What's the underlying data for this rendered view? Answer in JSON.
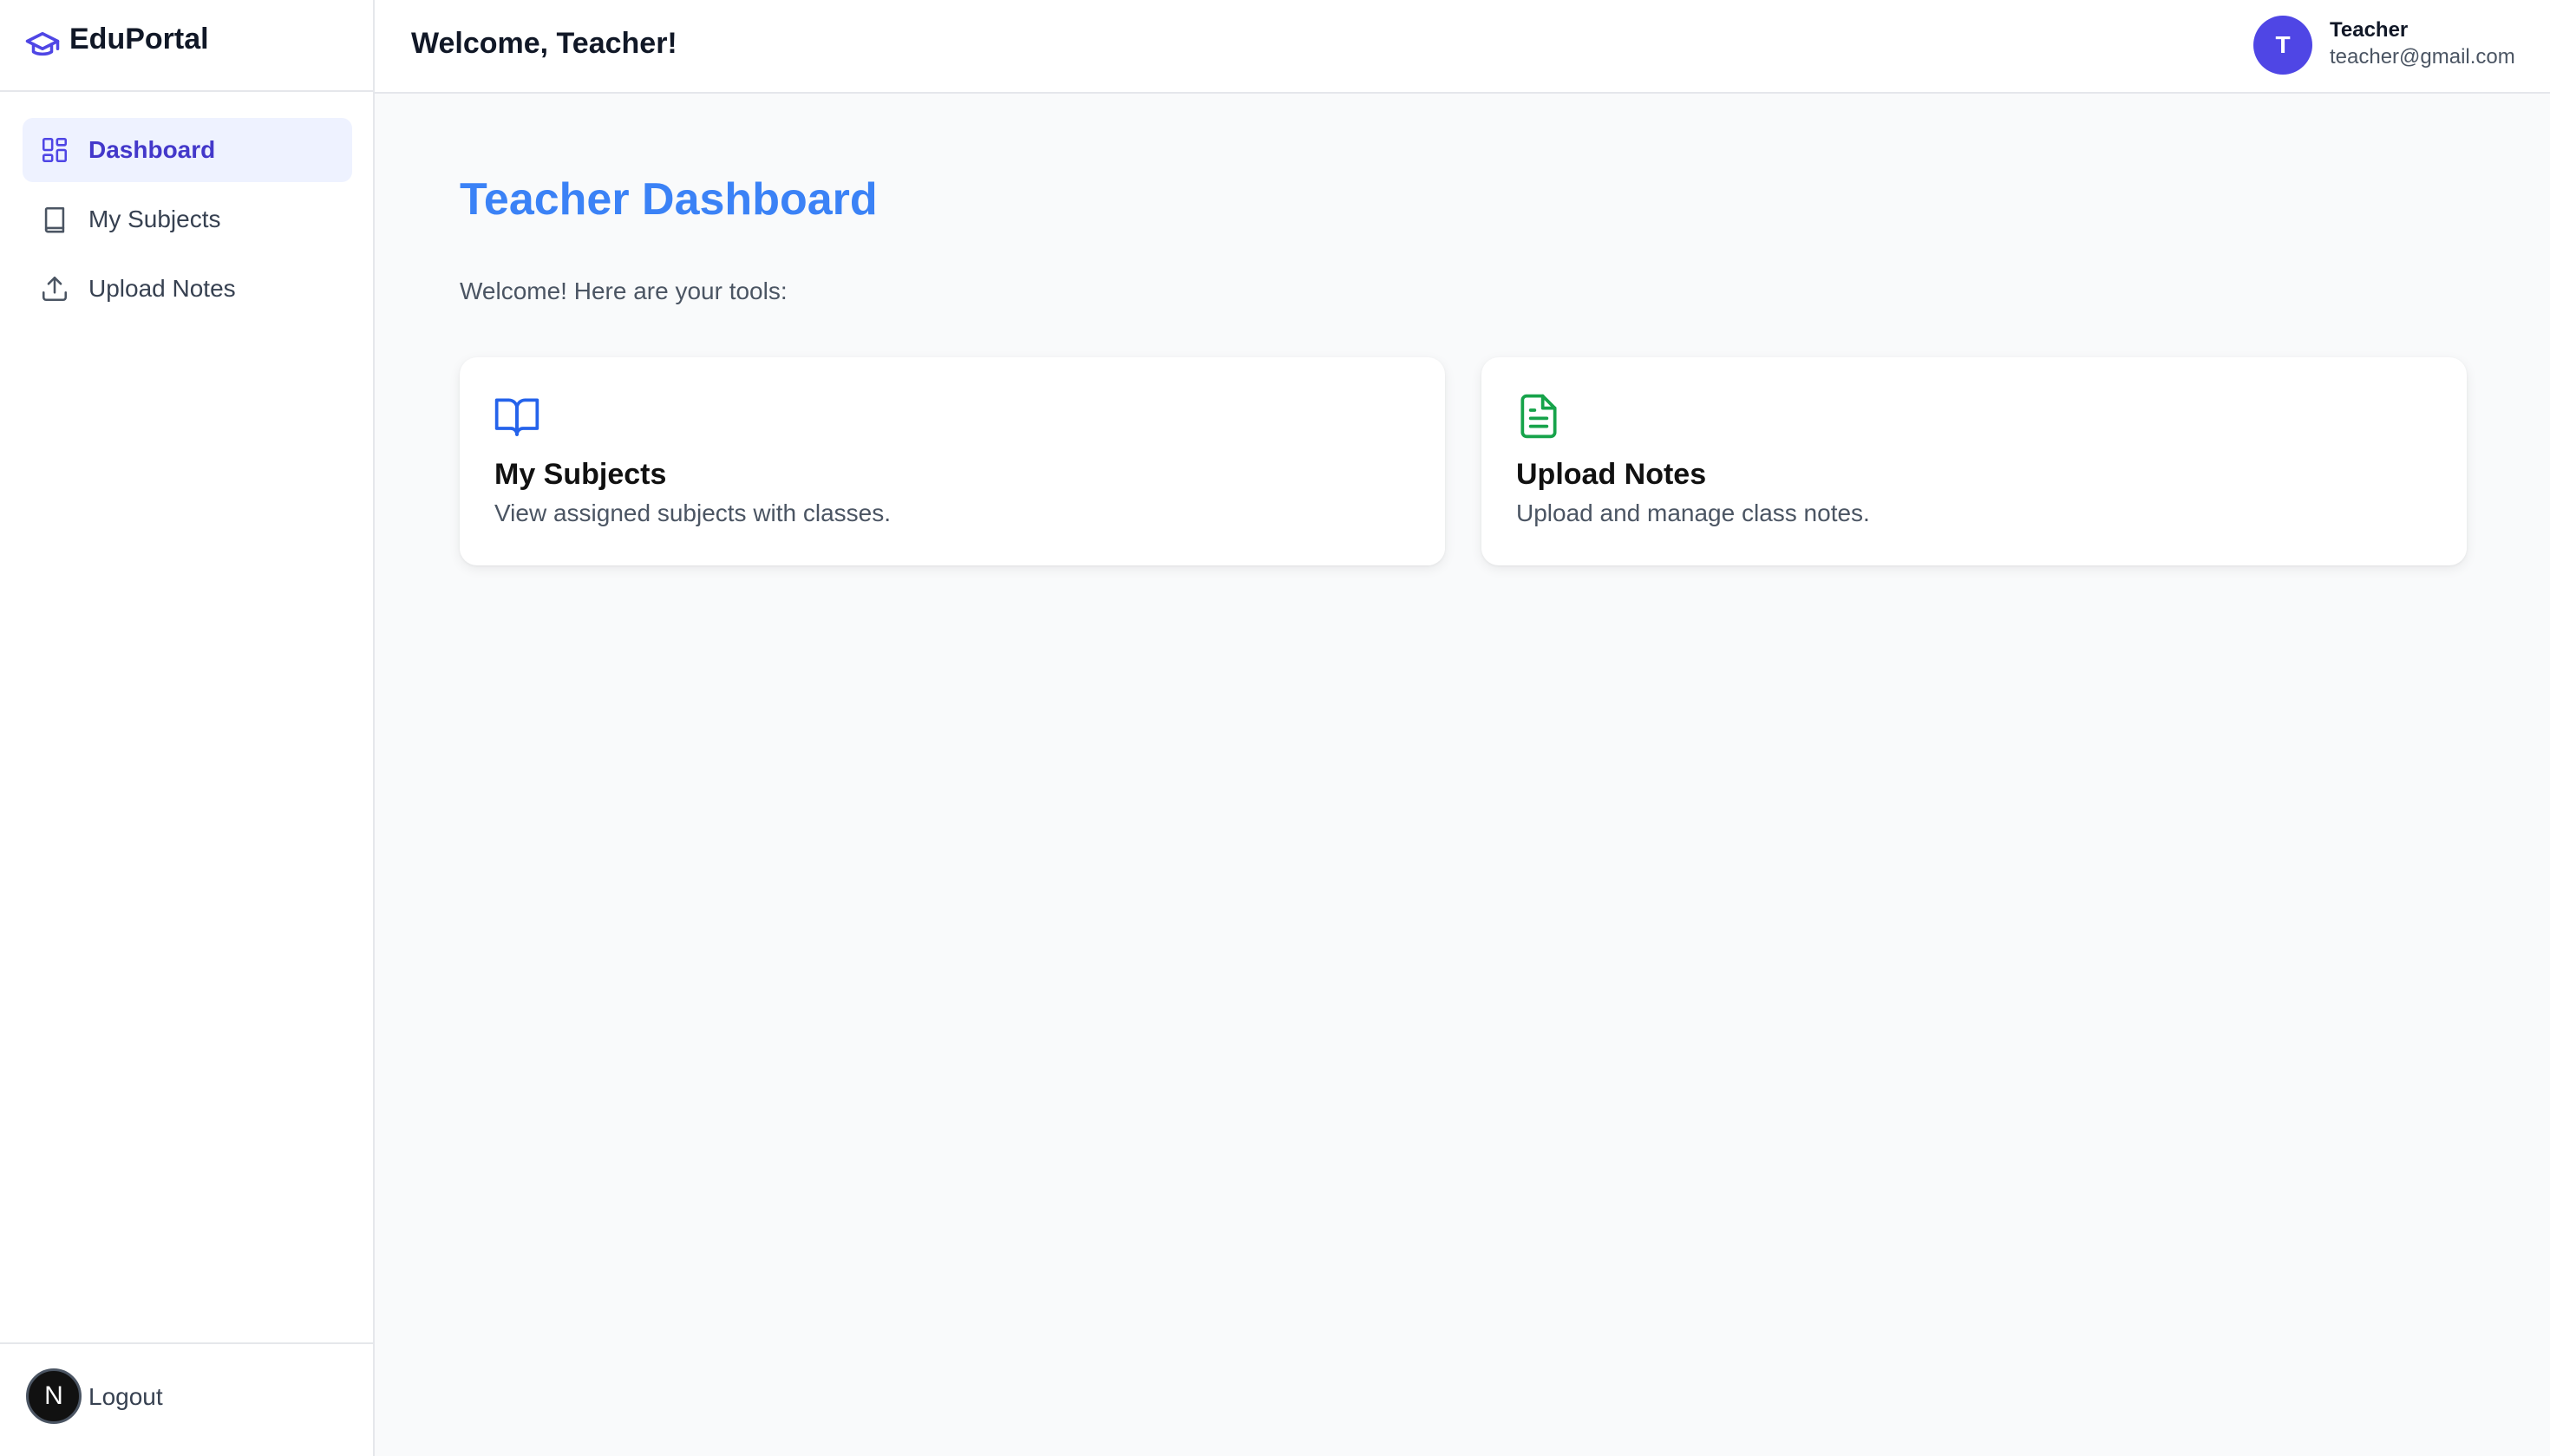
{
  "app": {
    "brand_name": "EduPortal",
    "brand_icon": "graduation-cap-icon",
    "accent_color": "#4f46e5"
  },
  "sidebar": {
    "items": [
      {
        "label": "Dashboard",
        "icon": "dashboard-grid-icon",
        "active": true
      },
      {
        "label": "My Subjects",
        "icon": "book-icon",
        "active": false
      },
      {
        "label": "Upload Notes",
        "icon": "upload-icon",
        "active": false
      }
    ],
    "logout": {
      "label": "Logout",
      "badge": "N"
    }
  },
  "header": {
    "title": "Welcome, Teacher!",
    "user": {
      "avatar_initial": "T",
      "name": "Teacher",
      "email": "teacher@gmail.com"
    }
  },
  "main": {
    "title": "Teacher Dashboard",
    "title_color": "#3b82f6",
    "subtitle": "Welcome! Here are your tools:",
    "cards": [
      {
        "title": "My Subjects",
        "description": "View assigned subjects with classes.",
        "icon": "open-book-icon",
        "icon_color": "#2563eb"
      },
      {
        "title": "Upload Notes",
        "description": "Upload and manage class notes.",
        "icon": "document-icon",
        "icon_color": "#16a34a"
      }
    ]
  }
}
